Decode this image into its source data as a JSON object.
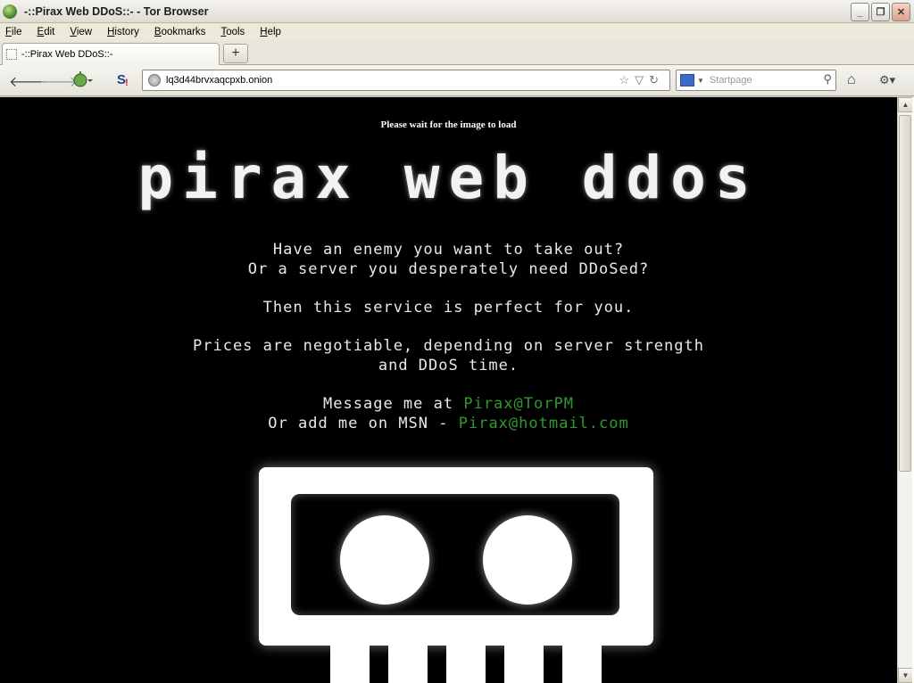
{
  "window": {
    "title": "-::Pirax Web DDoS::- - Tor Browser",
    "minimize_glyph": "_",
    "restore_glyph": "❐",
    "close_glyph": "✕"
  },
  "menu": {
    "items": [
      {
        "ul": "F",
        "rest": "ile"
      },
      {
        "ul": "E",
        "rest": "dit"
      },
      {
        "ul": "V",
        "rest": "iew"
      },
      {
        "ul": "H",
        "rest": "istory"
      },
      {
        "ul": "B",
        "rest": "ookmarks"
      },
      {
        "ul": "T",
        "rest": "ools"
      },
      {
        "ul": "H",
        "rest": "elp"
      }
    ]
  },
  "tabs": {
    "active_label": "-::Pirax Web DDoS::-",
    "new_tab_glyph": "+"
  },
  "nav": {
    "url": "lq3d44brvxaqcpxb.onion",
    "search_placeholder": "Startpage",
    "back_glyph": "🡐",
    "forward_glyph": "🡒",
    "home_glyph": "⌂"
  },
  "page": {
    "wait_text": "Please wait for the image to load",
    "logo_text": "pirax web ddos",
    "line1": "Have an enemy you want to take out?",
    "line2": "Or a server you desperately need DDoSed?",
    "line3": "Then this service is perfect for you.",
    "line4": "Prices are negotiable, depending on server strength",
    "line5": "and DDoS time.",
    "msg_prefix": "Message me at ",
    "msg_contact": "Pirax@TorPM",
    "msn_prefix": "Or add me on MSN - ",
    "msn_contact": "Pirax@hotmail.com"
  },
  "colors": {
    "page_background": "#000000",
    "text": "#e8e8e8",
    "contact_link": "#2e9a2e"
  }
}
